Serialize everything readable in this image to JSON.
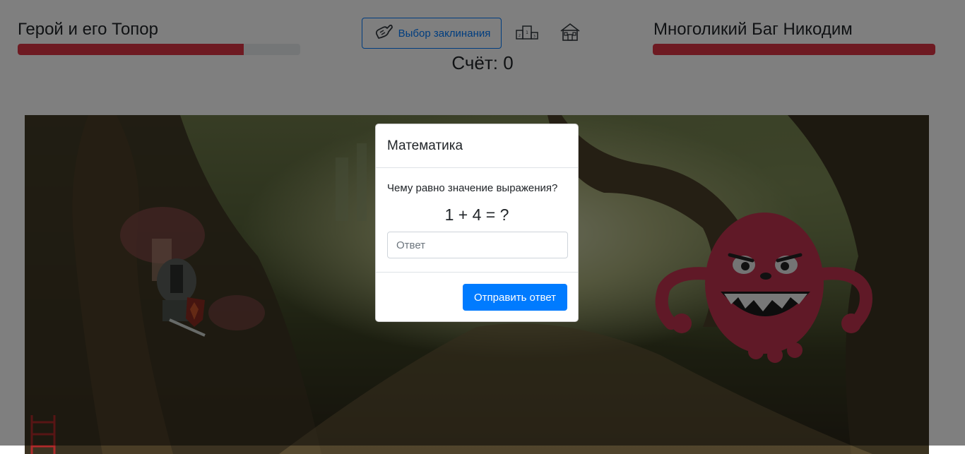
{
  "hero": {
    "name": "Герой и его Топор",
    "hp_fraction": 0.8,
    "hp_color": "#dc3545"
  },
  "enemy": {
    "name": "Многоликий Баг Никодим",
    "hp_fraction": 1.0,
    "hp_color": "#dc3545"
  },
  "toolbar": {
    "spell_label": "Выбор заклинания",
    "spell_icon": "spell-hand-icon",
    "leaderboard_icon": "podium-icon",
    "home_icon": "home-icon"
  },
  "score": {
    "label": "Счёт: 0"
  },
  "modal": {
    "title": "Математика",
    "question": "Чему равно значение выражения?",
    "expression": "1 + 4 = ?",
    "answer_placeholder": "Ответ",
    "answer_value": "",
    "submit_label": "Отправить ответ"
  },
  "colors": {
    "accent": "#007bff",
    "monster": "#c0334f",
    "overlay": "rgba(0,0,0,0.5)"
  }
}
